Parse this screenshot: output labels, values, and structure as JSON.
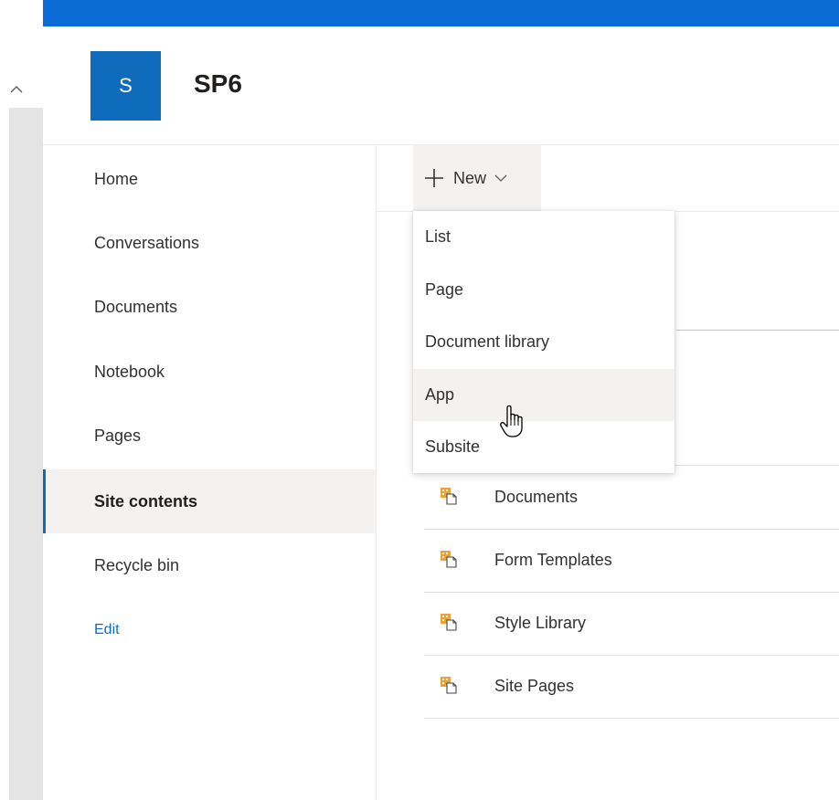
{
  "site": {
    "logo_letter": "S",
    "title": "SP6"
  },
  "colors": {
    "suite_bar": "#0a6cd4",
    "accent": "#0f6cbd",
    "selected_bg": "#f3f2f1",
    "library_icon": "#e8a33d"
  },
  "left_nav": {
    "items": [
      {
        "label": "Home"
      },
      {
        "label": "Conversations"
      },
      {
        "label": "Documents"
      },
      {
        "label": "Notebook"
      },
      {
        "label": "Pages"
      },
      {
        "label": "Site contents"
      },
      {
        "label": "Recycle bin"
      }
    ],
    "active_item": "Site contents",
    "edit_label": "Edit"
  },
  "command_bar": {
    "new_label": "New",
    "new_icon": "plus-icon",
    "dropdown_icon": "chevron-down-icon"
  },
  "new_menu": {
    "items": [
      {
        "label": "List"
      },
      {
        "label": "Page"
      },
      {
        "label": "Document library"
      },
      {
        "label": "App"
      },
      {
        "label": "Subsite"
      }
    ],
    "hovered_item": "App"
  },
  "contents": {
    "rows": [
      {
        "name": "Documents",
        "icon": "document-library-icon"
      },
      {
        "name": "Form Templates",
        "icon": "document-library-icon"
      },
      {
        "name": "Style Library",
        "icon": "document-library-icon"
      },
      {
        "name": "Site Pages",
        "icon": "document-library-icon"
      }
    ]
  }
}
